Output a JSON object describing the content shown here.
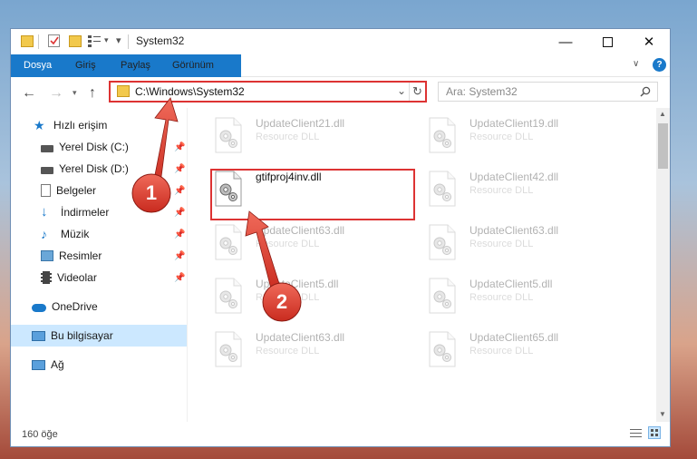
{
  "window": {
    "title": "System32"
  },
  "ribbon": {
    "tabs": [
      {
        "label": "Dosya"
      },
      {
        "label": "Giriş"
      },
      {
        "label": "Paylaş"
      },
      {
        "label": "Görünüm"
      }
    ]
  },
  "address": {
    "path": "C:\\Windows\\System32"
  },
  "search": {
    "placeholder": "Ara: System32"
  },
  "sidebar": {
    "items": [
      {
        "label": "Hızlı erişim",
        "icon": "star-icon"
      },
      {
        "label": "Yerel Disk (C:)",
        "icon": "drive-icon"
      },
      {
        "label": "Yerel Disk (D:)",
        "icon": "drive-icon"
      },
      {
        "label": "Belgeler",
        "icon": "document-icon"
      },
      {
        "label": "İndirmeler",
        "icon": "download-icon"
      },
      {
        "label": "Müzik",
        "icon": "music-icon"
      },
      {
        "label": "Resimler",
        "icon": "pictures-icon"
      },
      {
        "label": "Videolar",
        "icon": "video-icon"
      },
      {
        "label": "OneDrive",
        "icon": "cloud-icon"
      },
      {
        "label": "Bu bilgisayar",
        "icon": "computer-icon"
      },
      {
        "label": "Ağ",
        "icon": "network-icon"
      }
    ]
  },
  "files": [
    {
      "name": "UpdateClient21.dll",
      "type": "Resource DLL"
    },
    {
      "name": "UpdateClient19.dll",
      "type": "Resource DLL"
    },
    {
      "name": "gtifproj4inv.dll",
      "type": ""
    },
    {
      "name": "UpdateClient42.dll",
      "type": "Resource DLL"
    },
    {
      "name": "UpdateClient63.dll",
      "type": "Resource DLL"
    },
    {
      "name": "UpdateClient63.dll",
      "type": "Resource DLL"
    },
    {
      "name": "UpdateClient5.dll",
      "type": "Resource DLL"
    },
    {
      "name": "UpdateClient5.dll",
      "type": "Resource DLL"
    },
    {
      "name": "UpdateClient63.dll",
      "type": "Resource DLL"
    },
    {
      "name": "UpdateClient65.dll",
      "type": "Resource DLL"
    }
  ],
  "status": {
    "count": "160 öğe"
  },
  "callouts": {
    "one": "1",
    "two": "2"
  },
  "colors": {
    "accent": "#1979ca",
    "highlight": "#d33333",
    "selected": "#cce8ff"
  }
}
